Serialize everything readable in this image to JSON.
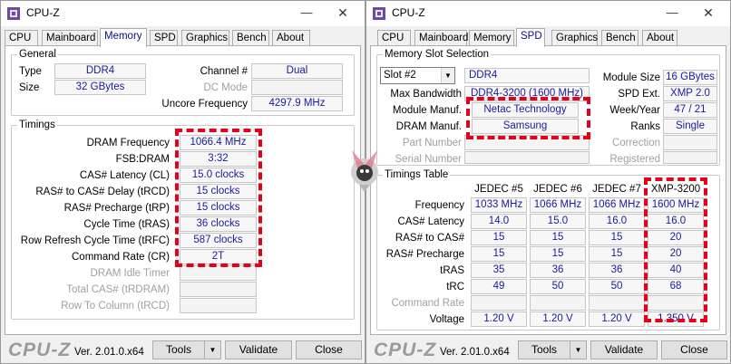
{
  "left": {
    "title": "CPU-Z",
    "tabs": [
      "CPU",
      "Mainboard",
      "Memory",
      "SPD",
      "Graphics",
      "Bench",
      "About"
    ],
    "general": {
      "title": "General",
      "type_label": "Type",
      "type_value": "DDR4",
      "size_label": "Size",
      "size_value": "32 GBytes",
      "channel_label": "Channel #",
      "channel_value": "Dual",
      "dcmode_label": "DC Mode",
      "dcmode_value": "",
      "uncore_label": "Uncore Frequency",
      "uncore_value": "4297.9 MHz"
    },
    "timings": {
      "title": "Timings",
      "rows": [
        {
          "label": "DRAM Frequency",
          "value": "1066.4 MHz"
        },
        {
          "label": "FSB:DRAM",
          "value": "3:32"
        },
        {
          "label": "CAS# Latency (CL)",
          "value": "15.0 clocks"
        },
        {
          "label": "RAS# to CAS# Delay (tRCD)",
          "value": "15 clocks"
        },
        {
          "label": "RAS# Precharge (tRP)",
          "value": "15 clocks"
        },
        {
          "label": "Cycle Time (tRAS)",
          "value": "36 clocks"
        },
        {
          "label": "Row Refresh Cycle Time (tRFC)",
          "value": "587 clocks"
        },
        {
          "label": "Command Rate (CR)",
          "value": "2T"
        },
        {
          "label": "DRAM Idle Timer",
          "value": ""
        },
        {
          "label": "Total CAS# (tRDRAM)",
          "value": ""
        },
        {
          "label": "Row To Column (tRCD)",
          "value": ""
        }
      ]
    }
  },
  "right": {
    "title": "CPU-Z",
    "tabs": [
      "CPU",
      "Mainboard",
      "Memory",
      "SPD",
      "Graphics",
      "Bench",
      "About"
    ],
    "slot": {
      "title": "Memory Slot Selection",
      "selected": "Slot #2",
      "type_value": "DDR4",
      "module_size_label": "Module Size",
      "module_size_value": "16 GBytes",
      "max_bw_label": "Max Bandwidth",
      "max_bw_value": "DDR4-3200 (1600 MHz)",
      "spd_ext_label": "SPD Ext.",
      "spd_ext_value": "XMP 2.0",
      "manuf_label": "Module Manuf.",
      "manuf_value": "Netac Technology",
      "weekyear_label": "Week/Year",
      "weekyear_value": "47 / 21",
      "dram_manuf_label": "DRAM Manuf.",
      "dram_manuf_value": "Samsung",
      "ranks_label": "Ranks",
      "ranks_value": "Single",
      "part_label": "Part Number",
      "correction_label": "Correction",
      "serial_label": "Serial Number",
      "registered_label": "Registered"
    },
    "timings_table": {
      "title": "Timings Table",
      "columns": [
        "JEDEC #5",
        "JEDEC #6",
        "JEDEC #7",
        "XMP-3200"
      ],
      "rows": [
        {
          "label": "Frequency",
          "values": [
            "1033 MHz",
            "1066 MHz",
            "1066 MHz",
            "1600 MHz"
          ]
        },
        {
          "label": "CAS# Latency",
          "values": [
            "14.0",
            "15.0",
            "16.0",
            "16.0"
          ]
        },
        {
          "label": "RAS# to CAS#",
          "values": [
            "15",
            "15",
            "15",
            "20"
          ]
        },
        {
          "label": "RAS# Precharge",
          "values": [
            "15",
            "15",
            "15",
            "20"
          ]
        },
        {
          "label": "tRAS",
          "values": [
            "35",
            "36",
            "36",
            "40"
          ]
        },
        {
          "label": "tRC",
          "values": [
            "49",
            "50",
            "50",
            "68"
          ]
        },
        {
          "label": "Command Rate",
          "values": [
            "",
            "",
            "",
            ""
          ]
        },
        {
          "label": "Voltage",
          "values": [
            "1.20 V",
            "1.20 V",
            "1.20 V",
            "1.350 V"
          ]
        }
      ]
    }
  },
  "footer": {
    "brand": "CPU-Z",
    "version": "Ver. 2.01.0.x64",
    "tools_label": "Tools",
    "validate_label": "Validate",
    "close_label": "Close"
  },
  "colors": {
    "value_text": "#1a1a9a",
    "highlight_dash": "#e4001a",
    "active_tab_text": "#0a0a8a"
  },
  "icons": {
    "app": "cpuz-app-icon",
    "minimize": "minimize-icon",
    "close": "close-icon",
    "dropdown": "chevron-down-icon",
    "watermark": "watermark-logo"
  }
}
